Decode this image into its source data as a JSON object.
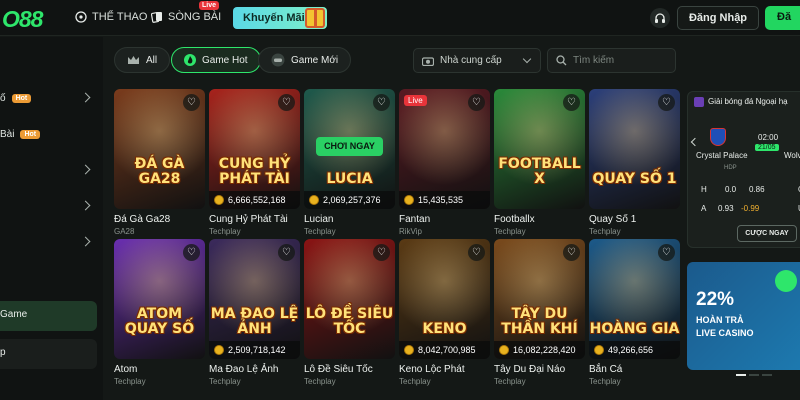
{
  "header": {
    "logo": "O88",
    "nav": [
      {
        "label": "THỂ THAO",
        "icon": "soccer-ball-icon"
      },
      {
        "label": "SÒNG BÀI",
        "icon": "cards-icon",
        "badge": "Live"
      }
    ],
    "promo_label": "Khuyến Mãi",
    "login_label": "Đăng Nhập",
    "register_label": "Đă"
  },
  "sidebar": {
    "items": [
      {
        "label": "ố",
        "tag": "Hot"
      },
      {
        "label": "Bài",
        "tag": "Hot"
      },
      {
        "label": ""
      },
      {
        "label": ""
      },
      {
        "label": ""
      }
    ],
    "active_label": "Game",
    "last_label": "p"
  },
  "filters": {
    "chips": [
      {
        "label": "All",
        "icon": "crown-icon"
      },
      {
        "label": "Game Hot",
        "icon": "flame-icon",
        "active": true
      },
      {
        "label": "Game Mới",
        "icon": "controller-icon"
      }
    ],
    "provider_label": "Nhà cung cấp",
    "search_placeholder": "Tìm kiếm"
  },
  "games": [
    {
      "name": "Đá Gà Ga28",
      "provider": "GA28",
      "art": "ĐÁ GÀ GA28",
      "jackpot": "",
      "bg": "#7a3b1c"
    },
    {
      "name": "Cung Hỷ Phát Tài",
      "provider": "Techplay",
      "art": "CUNG HỶ PHÁT TÀI",
      "jackpot": "6,666,552,168",
      "bg": "#a8231c"
    },
    {
      "name": "Lucian",
      "provider": "Techplay",
      "art": "LUCIA",
      "jackpot": "2,069,257,376",
      "bg": "#1f5a4c",
      "cta": "CHƠI NGAY"
    },
    {
      "name": "Fantan",
      "provider": "RikVip",
      "art": "",
      "jackpot": "15,435,535",
      "bg": "#5a1a22",
      "live": "Live"
    },
    {
      "name": "Footballx",
      "provider": "Techplay",
      "art": "FOOTBALL X",
      "jackpot": "",
      "bg": "#2a8a3a"
    },
    {
      "name": "Quay Số 1",
      "provider": "Techplay",
      "art": "QUAY SỐ 1",
      "jackpot": "",
      "bg": "#2b3f7a"
    },
    {
      "name": "Atom",
      "provider": "Techplay",
      "art": "ATOM QUAY SỐ",
      "jackpot": "",
      "bg": "#6a2fb0"
    },
    {
      "name": "Ma Đao Lệ Ảnh",
      "provider": "Techplay",
      "art": "MA ĐAO LỆ ẢNH",
      "jackpot": "2,509,718,142",
      "bg": "#3b2a5c"
    },
    {
      "name": "Lô Đề Siêu Tốc",
      "provider": "Techplay",
      "art": "LÔ ĐỀ SIÊU TỐC",
      "jackpot": "",
      "bg": "#8a1414"
    },
    {
      "name": "Keno Lộc Phát",
      "provider": "Techplay",
      "art": "KENO",
      "jackpot": "8,042,700,985",
      "bg": "#5a3a14"
    },
    {
      "name": "Tây Du Đại Náo",
      "provider": "Techplay",
      "art": "TÂY DU THẦN KHÍ",
      "jackpot": "16,082,228,420",
      "bg": "#7a4a1c"
    },
    {
      "name": "Bắn Cá",
      "provider": "Techplay",
      "art": "HOÀNG GIA",
      "jackpot": "49,266,656",
      "bg": "#1c5a8a"
    }
  ],
  "match": {
    "league": "Giải bóng đá Ngoại hạ",
    "team_home": "Crystal Palace",
    "team_away": "Wolv",
    "time": "02:00",
    "date": "21/05",
    "headers": {
      "hdp": "HDP",
      "ou": "O"
    },
    "rows": [
      {
        "label": "H",
        "hdp": "0.0",
        "odds": "0.86",
        "extra": "O"
      },
      {
        "label": "A",
        "hdp": "0.93",
        "odds": "-0.99",
        "extra": "U"
      }
    ],
    "bet_label": "CƯỢC NGAY"
  },
  "promo": {
    "big": "22%",
    "line1": "HOÀN TRẢ",
    "line2": "LIVE CASINO"
  },
  "colors": {
    "accent": "#2ee66b",
    "background": "#141816",
    "hot_tag": "#ec9b35",
    "live": "#e8343a"
  }
}
